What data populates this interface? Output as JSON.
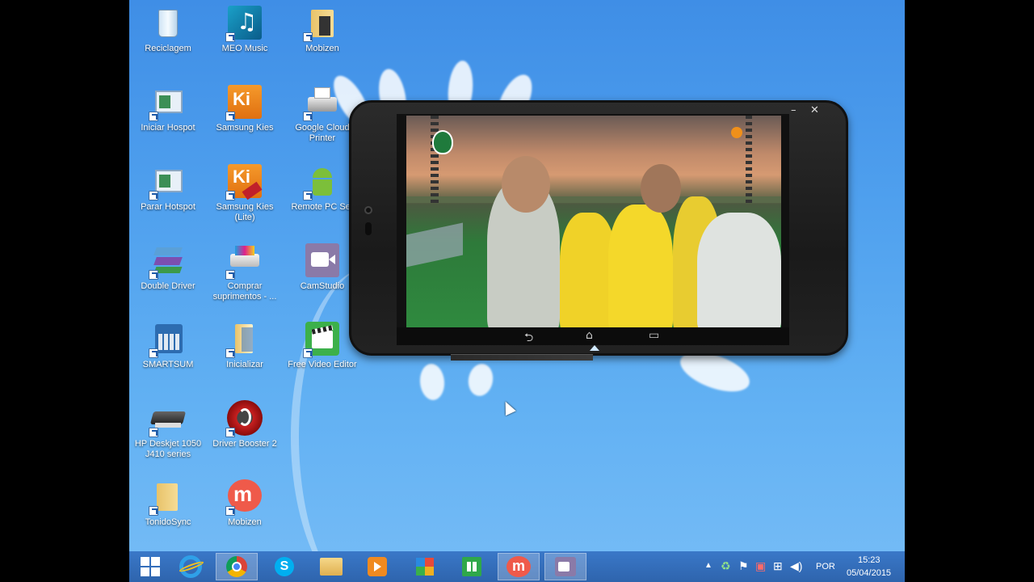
{
  "desktop": {
    "icons": [
      {
        "label": "Reciclagem",
        "icon": "recycle-bin-icon"
      },
      {
        "label": "MEO Music",
        "icon": "music-icon"
      },
      {
        "label": "Mobizen",
        "icon": "folder-icon"
      },
      {
        "label": "Iniciar Hospot",
        "icon": "window-icon"
      },
      {
        "label": "Samsung Kies",
        "icon": "samsung-kies-icon"
      },
      {
        "label": "Google Cloud Printer",
        "icon": "printer-icon"
      },
      {
        "label": "Parar Hotspot",
        "icon": "window-icon"
      },
      {
        "label": "Samsung Kies (Lite)",
        "icon": "samsung-kies-lite-icon"
      },
      {
        "label": "Remote PC Ser",
        "icon": "android-icon"
      },
      {
        "label": "Double Driver",
        "icon": "double-driver-icon"
      },
      {
        "label": "Comprar suprimentos - ...",
        "icon": "printer-supplies-icon"
      },
      {
        "label": "CamStudio",
        "icon": "camstudio-icon"
      },
      {
        "label": "SMARTSUM",
        "icon": "calculator-icon"
      },
      {
        "label": "Inicializar",
        "icon": "document-folder-icon"
      },
      {
        "label": "Free Video Editor",
        "icon": "video-editor-icon"
      },
      {
        "label": "HP Deskjet 1050 J410 series",
        "icon": "hp-printer-icon"
      },
      {
        "label": "Driver Booster 2",
        "icon": "driver-booster-icon"
      },
      {
        "label": "TonidoSync",
        "icon": "folder-icon"
      },
      {
        "label": "Mobizen",
        "icon": "mobizen-icon"
      }
    ]
  },
  "phone_window": {
    "minimize_label": "–",
    "close_label": "✕",
    "nav": {
      "back": "⮌",
      "home": "⌂",
      "recents": "▭"
    }
  },
  "taskbar": {
    "items": [
      {
        "name": "start-button",
        "icon": "windows-logo-icon",
        "active": false
      },
      {
        "name": "taskbar-internet-explorer",
        "icon": "internet-explorer-icon",
        "active": false
      },
      {
        "name": "taskbar-chrome",
        "icon": "chrome-icon",
        "active": true
      },
      {
        "name": "taskbar-skype",
        "icon": "skype-icon",
        "active": false
      },
      {
        "name": "taskbar-file-explorer",
        "icon": "folder-icon",
        "active": false
      },
      {
        "name": "taskbar-media-player",
        "icon": "media-player-icon",
        "active": false
      },
      {
        "name": "taskbar-apps",
        "icon": "apps-grid-icon",
        "active": false
      },
      {
        "name": "taskbar-store",
        "icon": "store-icon",
        "active": false
      },
      {
        "name": "taskbar-mobizen",
        "icon": "mobizen-icon",
        "active": true
      },
      {
        "name": "taskbar-camstudio",
        "icon": "camstudio-icon",
        "active": true
      }
    ],
    "tray": {
      "language": "POR",
      "time": "15:23",
      "date": "05/04/2015"
    }
  }
}
